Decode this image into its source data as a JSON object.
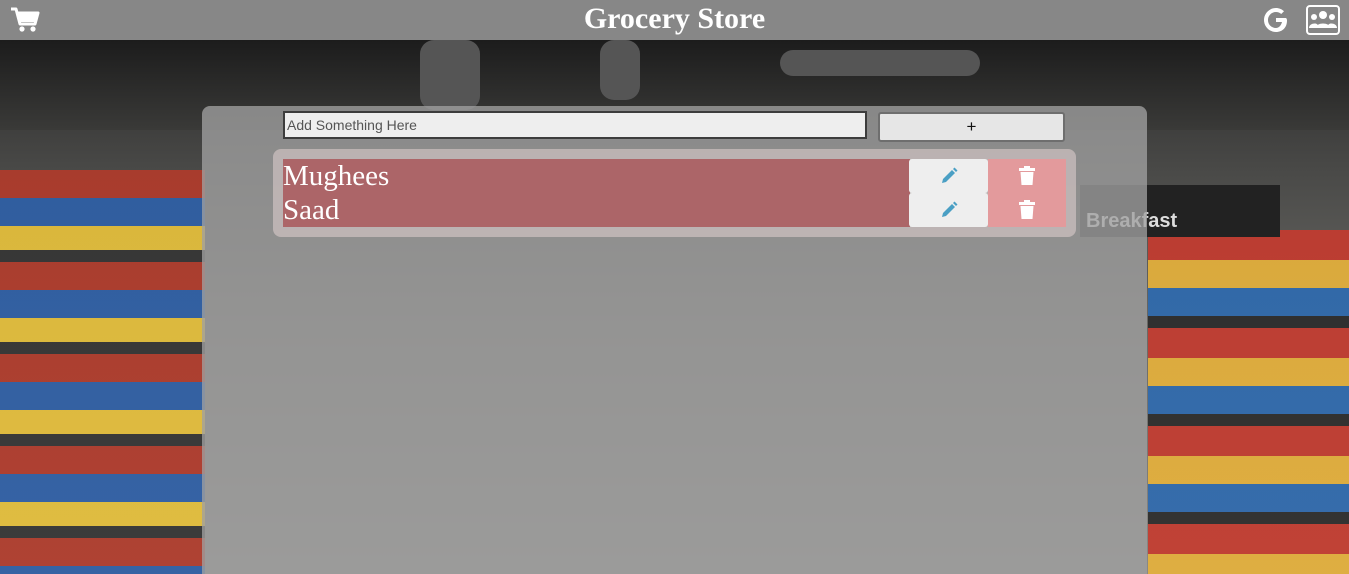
{
  "header": {
    "title": "Grocery Store",
    "cart_icon": "cart-icon",
    "google_icon": "google-icon",
    "users_icon": "users-icon"
  },
  "background": {
    "sign_label": "Breakfast"
  },
  "form": {
    "input_placeholder": "Add Something Here",
    "input_value": "",
    "add_label": "+"
  },
  "items": [
    {
      "name": "Mughees"
    },
    {
      "name": "Saad"
    }
  ],
  "colors": {
    "header_bg": "#878787",
    "item_bg": "#a85458",
    "edit_icon": "#4a9fc4",
    "delete_bg": "#e39a9c"
  }
}
